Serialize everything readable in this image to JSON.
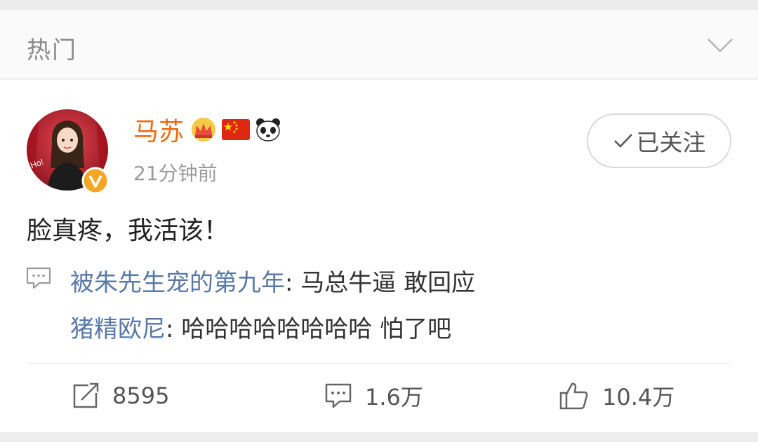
{
  "section": {
    "title": "热门"
  },
  "post": {
    "user_name": "马苏",
    "time": "21分钟前",
    "follow_label": "已关注",
    "text": "脸真疼，我活该！",
    "comments": [
      {
        "author": "被朱先生宠的第九年",
        "text": "马总牛逼 敢回应"
      },
      {
        "author": "猪精欧尼",
        "text": "哈哈哈哈哈哈哈哈 怕了吧"
      }
    ],
    "actions": {
      "reposts": "8595",
      "comments": "1.6万",
      "likes": "10.4万"
    }
  },
  "colors": {
    "name": "#f26a12",
    "comment_author": "#5878a8",
    "verified_badge": "#f5a623"
  }
}
